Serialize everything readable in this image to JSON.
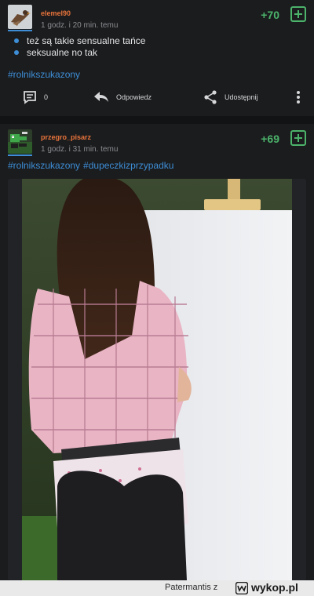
{
  "posts": [
    {
      "username": "elemel90",
      "time": "1 godz. i 20 min. temu",
      "score": "+70",
      "lines": [
        "też są takie sensualne tańce",
        "seksualne no tak"
      ],
      "tags": [
        "#rolnikszukazony"
      ],
      "actions": {
        "comments_count": "0",
        "reply_label": "Odpowiedz",
        "share_label": "Udostępnij"
      },
      "icons": {
        "avatar": "bird-avatar",
        "comment": "comment-icon",
        "reply": "reply-arrow-icon",
        "share": "share-icon",
        "more": "more-vertical-icon",
        "plus": "plus-icon"
      }
    },
    {
      "username": "przegro_pisarz",
      "time": "1 godz. i 31 min. temu",
      "score": "+69",
      "tags": [
        "#rolnikszukazony",
        "#dupeczkizprzypadku"
      ],
      "icons": {
        "avatar": "pixel-art-avatar",
        "plus": "plus-icon"
      }
    }
  ],
  "footer": {
    "text": "Patermantis z",
    "brand": "wykop.pl"
  },
  "colors": {
    "background": "#1b1c1e",
    "username": "#e8743b",
    "score": "#4cb36b",
    "link": "#3d8ed6",
    "meta": "#8a8c90"
  }
}
